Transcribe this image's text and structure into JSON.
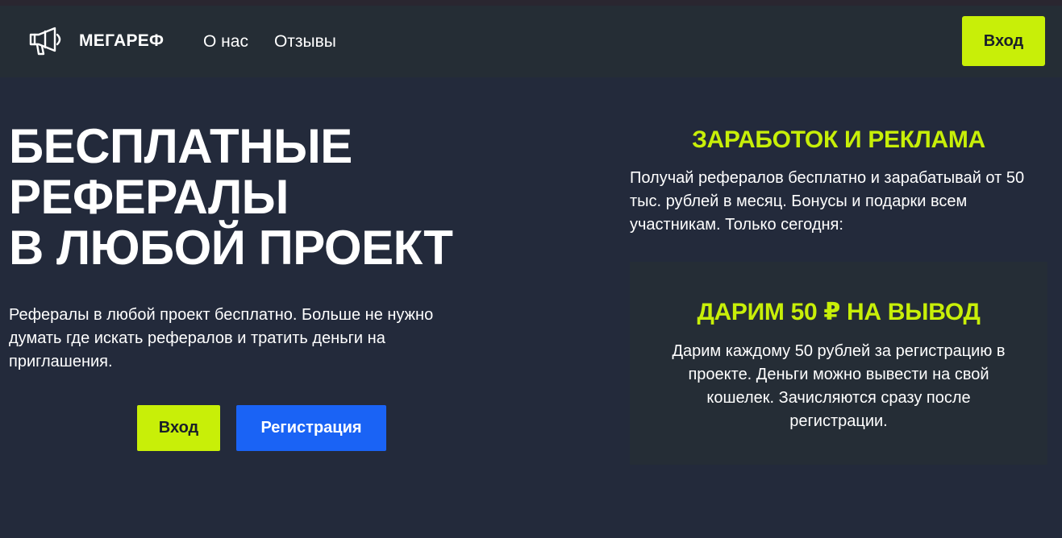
{
  "header": {
    "logo_text": "МЕГАРЕФ",
    "logo_icon": "megaphone-icon",
    "nav": [
      "О нас",
      "Отзывы"
    ],
    "login_label": "Вход"
  },
  "hero": {
    "title_lines": [
      "БЕСПЛАТНЫЕ",
      "РЕФЕРАЛЫ",
      "В ЛЮБОЙ ПРОЕКТ"
    ],
    "subtitle": "Рефералы в любой проект бесплатно. Больше не нужно думать где искать рефералов и тратить деньги на приглашения.",
    "login_label": "Вход",
    "register_label": "Регистрация"
  },
  "side": {
    "title": "ЗАРАБОТОК И РЕКЛАМА",
    "text": "Получай рефералов бесплатно и зарабатывай от 50 тыс. рублей в месяц. Бонусы и подарки всем участникам. Только сегодня:"
  },
  "promo": {
    "title": "ДАРИМ 50 ₽ НА ВЫВОД",
    "text": "Дарим каждому 50 рублей за регистрацию в проекте. Деньги можно вывести на свой кошелек. Зачисляются сразу после регистрации."
  },
  "colors": {
    "background": "#232a3b",
    "header": "#252d35",
    "accent": "#c8ef08",
    "primary_button": "#1a63f5"
  }
}
